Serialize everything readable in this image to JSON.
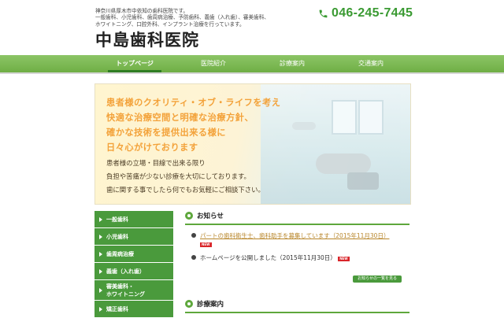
{
  "header": {
    "intro": "神奈川県厚木市中依知の歯科医院です。\n一般歯科、小児歯科、歯周病治療、予防歯科、義歯（入れ歯）、審美歯科、\nホワイトニング、口腔外科、インプラント治療を行っています。",
    "title": "中島歯科医院",
    "phone": "046-245-7445",
    "phone_icon": "phone-icon"
  },
  "nav": {
    "items": [
      {
        "label": "トップページ",
        "active": true
      },
      {
        "label": "医院紹介",
        "active": false
      },
      {
        "label": "診療案内",
        "active": false
      },
      {
        "label": "交通案内",
        "active": false
      }
    ]
  },
  "hero": {
    "headline": "患者様のクオリティ・オブ・ライフを考え\n快適な治療空間と明確な治療方針、\n確かな技術を提供出来る様に\n日々心がけております",
    "body": "患者様の立場・目線で出来る限り\n負担や苦痛が少ない診療を大切にしております。\n歯に関する事でしたら何でもお気軽にご相談下さい。"
  },
  "sidebar": {
    "items": [
      {
        "label": "一般歯科"
      },
      {
        "label": "小児歯科"
      },
      {
        "label": "歯周病治療"
      },
      {
        "label": "義歯（入れ歯）"
      },
      {
        "label": "審美歯科・\nホワイトニング"
      },
      {
        "label": "矯正歯科"
      }
    ]
  },
  "news": {
    "title": "お知らせ",
    "items": [
      {
        "text": "パートの歯科衛生士、歯科助手を募集しています（2015年11月30日）",
        "link": true,
        "badge": "NEW"
      },
      {
        "text": "ホームページを公開しました（2015年11月30日）",
        "link": false,
        "badge": "NEW"
      }
    ],
    "more_label": "お知らせの一覧を見る"
  },
  "services": {
    "title": "診療案内"
  },
  "colors": {
    "accent": "#5ea73c",
    "phone": "#3a9a32",
    "hero_headline": "#f3a23a",
    "badge": "#d9252a"
  }
}
